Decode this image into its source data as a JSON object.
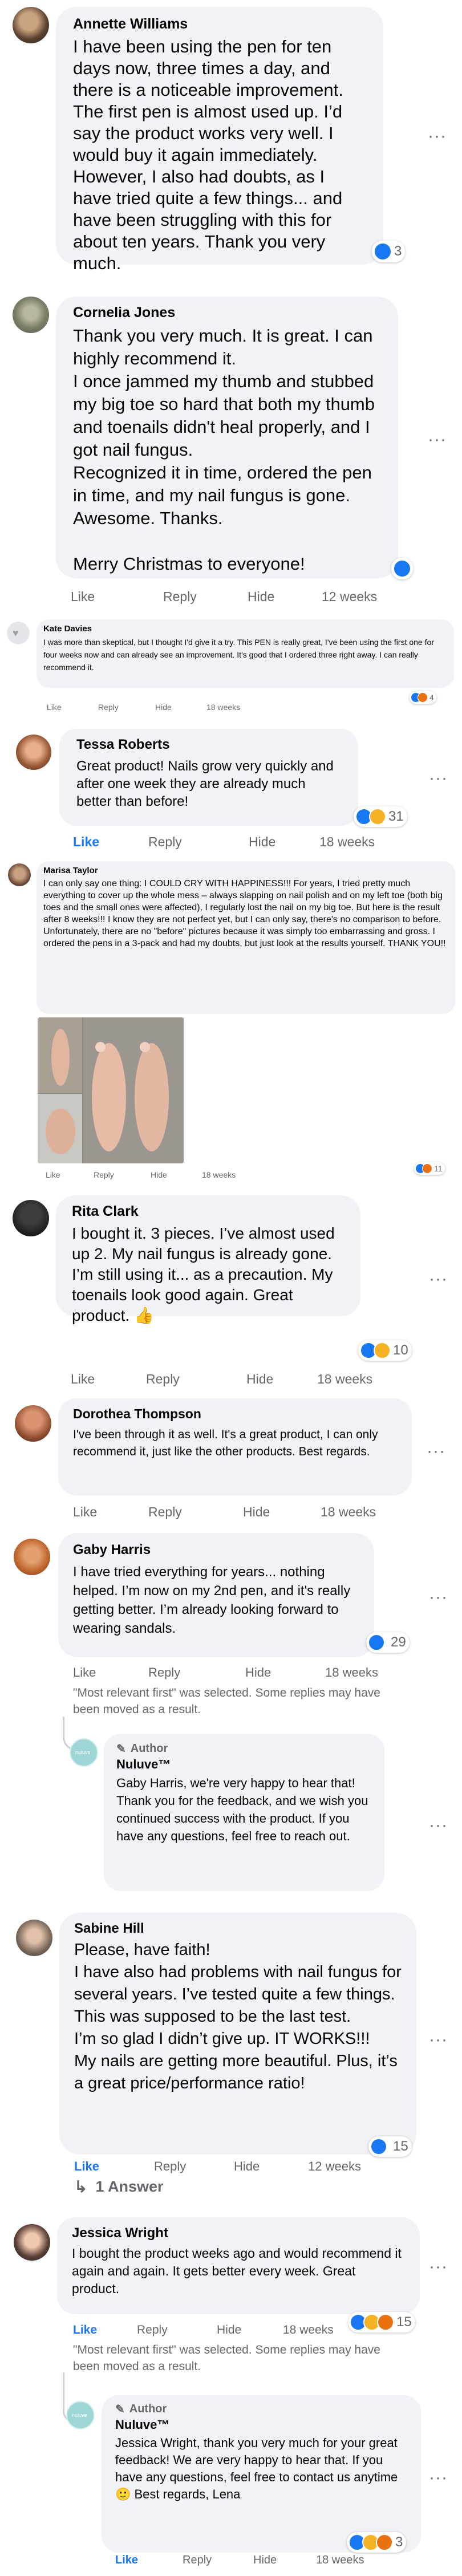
{
  "colors": {
    "bubble": "#f0f2f5",
    "meta": "#65676b",
    "link": "#1877f2",
    "text": "#050505"
  },
  "comments": [
    {
      "name": "Annette Williams",
      "text": "I have been using the pen for ten days now, three times a day, and there is a noticeable improvement. The first pen is almost used up. I’d say the product works very well. I would buy it again immediately. However, I also had doubts, as I have tried quite a few things... and have been struggling with this for about ten years. Thank you very much.",
      "reactions": "3"
    },
    {
      "name": "Cornelia Jones",
      "text": "Thank you very much. It is great. I can highly recommend it.\nI once jammed my thumb and stubbed my big toe so hard that both my thumb and toenails didn't heal properly, and I got nail fungus.\nRecognized it in time, ordered the pen in time, and my nail fungus is gone. Awesome. Thanks.\n\nMerry Christmas to everyone!",
      "actions": {
        "like": "Like",
        "reply": "Reply",
        "hide": "Hide",
        "time": "12 weeks"
      }
    },
    {
      "name": "Kate Davies",
      "text": "I was more than skeptical, but I thought I'd give it a try. This PEN is really great, I've been using the first one for four weeks now and can already see an improvement. It's good that I ordered three right away. I can really recommend it.",
      "actions": {
        "like": "Like",
        "reply": "Reply",
        "hide": "Hide",
        "time": "18 weeks"
      },
      "reactions": "4"
    },
    {
      "name": "Tessa Roberts",
      "text": "Great product! Nails grow very quickly and after one week they are already much better than before!",
      "actions": {
        "like": "Like",
        "reply": "Reply",
        "hide": "Hide",
        "time": "18 weeks"
      },
      "reactions": "31"
    },
    {
      "name": "Marisa Taylor",
      "text": "I can only say one thing: I COULD CRY WITH HAPPINESS!!! For years, I tried pretty much everything to cover up the whole mess – always slapping on nail polish and on my left toe (both big toes and the small ones were affected), I regularly lost the nail on my big toe. But here is the result after 8 weeks!!! I know they are not perfect yet, but I can only say, there's no comparison to before. Unfortunately, there are no \"before\" pictures because it was simply too embarrassing and gross. I ordered the pens in a 3-pack and had my doubts, but just look at the results yourself. THANK YOU!!",
      "actions": {
        "like": "Like",
        "reply": "Reply",
        "hide": "Hide",
        "time": "18 weeks"
      },
      "reactions": "11"
    },
    {
      "name": "Rita Clark",
      "text": "I bought it. 3 pieces. I’ve almost used up 2. My nail fungus is already gone. I’m still using it... as a precaution. My toenails look good again. Great product. 👍",
      "actions": {
        "like": "Like",
        "reply": "Reply",
        "hide": "Hide",
        "time": "18 weeks"
      },
      "reactions": "10"
    },
    {
      "name": "Dorothea Thompson",
      "text": "I've been through it as well. It's a great product, I can only recommend it, just like the other products. Best regards.",
      "actions": {
        "like": "Like",
        "reply": "Reply",
        "hide": "Hide",
        "time": "18 weeks"
      }
    },
    {
      "name": "Gaby Harris",
      "text": "I have tried everything for years... nothing helped. I’m now on my 2nd pen, and it's really getting better. I’m already looking forward to wearing sandals.",
      "actions": {
        "like": "Like",
        "reply": "Reply",
        "hide": "Hide",
        "time": "18 weeks"
      },
      "reactions": "29",
      "note": "\"Most relevant first\" was selected. Some replies may have been moved as a result."
    },
    {
      "author_badge": "Author",
      "name": "Nuluve™",
      "text": "Gaby Harris, we're very happy to hear that! Thank you for the feedback, and we wish you continued success with the product. If you have any questions, feel free to reach out."
    },
    {
      "name": "Sabine Hill",
      "text": "Please, have faith!\nI have also had problems with nail fungus for several years. I’ve tested quite a few things. This was supposed to be the last test.\nI’m so glad I didn’t give up. IT WORKS!!!\nMy nails are getting more beautiful. Plus, it’s a great price/performance ratio!",
      "actions": {
        "like": "Like",
        "reply": "Reply",
        "hide": "Hide",
        "time": "12 weeks"
      },
      "reactions": "15",
      "answers": "1 Answer"
    },
    {
      "name": "Jessica Wright",
      "text": "I bought the product weeks ago and would recommend it again and again. It gets better every week. Great product.",
      "actions": {
        "like": "Like",
        "reply": "Reply",
        "hide": "Hide",
        "time": "18 weeks"
      },
      "reactions": "15",
      "note": "\"Most relevant first\" was selected. Some replies may have been moved as a result."
    },
    {
      "author_badge": "Author",
      "name": "Nuluve™",
      "text": "Jessica Wright, thank you very much for your great feedback! We are very happy to hear that. If you have any questions, feel free to contact us anytime 🙂 Best regards, Lena",
      "actions": {
        "like": "Like",
        "reply": "Reply",
        "hide": "Hide",
        "time": "18 weeks"
      },
      "reactions": "3"
    }
  ]
}
